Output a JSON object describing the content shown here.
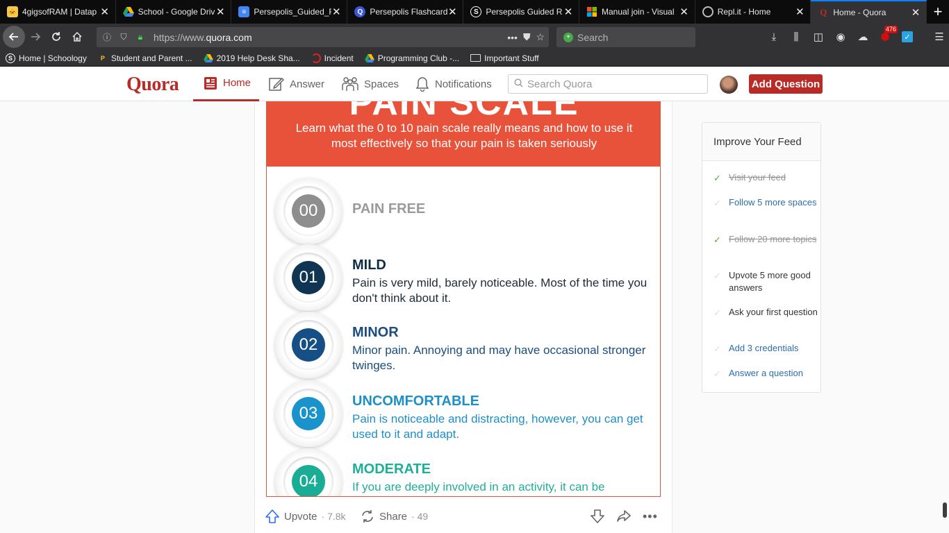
{
  "browser": {
    "tabs": [
      {
        "title": "4gigsofRAM | Datap",
        "icon": "cat-icon",
        "color": "#f2c94c"
      },
      {
        "title": "School - Google Driv",
        "icon": "google-drive-icon",
        "color": "#1fa463"
      },
      {
        "title": "Persepolis_Guided_F",
        "icon": "google-docs-icon",
        "color": "#4285f4"
      },
      {
        "title": "Persepolis Flashcard",
        "icon": "quizlet-icon",
        "color": "#3c56d6"
      },
      {
        "title": "Persepolis Guided R",
        "icon": "schoology-icon",
        "color": "#2b8bc9"
      },
      {
        "title": "Manual join - Visual",
        "icon": "microsoft-icon",
        "color": "#f25022"
      },
      {
        "title": "Repl.it - Home",
        "icon": "replit-icon",
        "color": "#888888"
      },
      {
        "title": "Home - Quora",
        "icon": "quora-icon",
        "color": "#b92b27",
        "active": true
      }
    ],
    "url_prefix": "https://www.",
    "url_domain": "quora.com",
    "search_placeholder": "Search",
    "badge_count": "476",
    "bookmarks": [
      {
        "label": "Home | Schoology",
        "icon": "schoology-icon"
      },
      {
        "label": "Student and Parent ...",
        "icon": "pearson-icon"
      },
      {
        "label": "2019 Help Desk Sha...",
        "icon": "google-drive-icon"
      },
      {
        "label": "Incident",
        "icon": "servicenow-icon"
      },
      {
        "label": "Programming Club -...",
        "icon": "google-drive-icon"
      },
      {
        "label": "Important Stuff",
        "icon": "folder-icon"
      }
    ]
  },
  "quora": {
    "logo": "Quora",
    "nav": {
      "home": "Home",
      "answer": "Answer",
      "spaces": "Spaces",
      "notifications": "Notifications"
    },
    "search_placeholder": "Search Quora",
    "add_question": "Add Question"
  },
  "infographic": {
    "big_title": "PAIN SCALE",
    "subtitle": "Learn what the 0 to 10 pain scale really means and how to use it most effectively so that your pain is taken seriously",
    "levels": [
      {
        "num": "00",
        "title": "PAIN FREE",
        "desc": "",
        "color": "#8e8e8e",
        "title_color": "#9a9a9a",
        "desc_color": "#333333"
      },
      {
        "num": "01",
        "title": "MILD",
        "desc": "Pain is very mild, barely noticeable. Most of the time you don't think about it.",
        "color": "#0f3552",
        "title_color": "#0f2c45",
        "desc_color": "#1d2b38"
      },
      {
        "num": "02",
        "title": "MINOR",
        "desc": "Minor pain. Annoying and may have occasional stronger twinges.",
        "color": "#154f86",
        "title_color": "#1b4d7e",
        "desc_color": "#1b4d7e"
      },
      {
        "num": "03",
        "title": "UNCOMFORTABLE",
        "desc": "Pain is noticeable and distracting, however, you can get used to it and adapt.",
        "color": "#1a93cc",
        "title_color": "#1e8fc6",
        "desc_color": "#1e8fc6"
      },
      {
        "num": "04",
        "title": "MODERATE",
        "desc": "If you are deeply involved in an activity, it can be",
        "color": "#1aad96",
        "title_color": "#1fae97",
        "desc_color": "#1fae97"
      }
    ]
  },
  "actions": {
    "upvote_label": "Upvote",
    "upvote_count": "7.8k",
    "share_label": "Share",
    "share_count": "49"
  },
  "sidebar": {
    "title": "Improve Your Feed",
    "items": [
      {
        "text": "Visit your feed",
        "state": "done"
      },
      {
        "text": "Follow 5 more spaces",
        "state": "link"
      },
      {
        "text": "Follow 20 more topics",
        "state": "done"
      },
      {
        "text": "Upvote 5 more good answers",
        "state": "plain"
      },
      {
        "text": "Ask your first question",
        "state": "plain"
      },
      {
        "text": "Add 3 credentials",
        "state": "link"
      },
      {
        "text": "Answer a question",
        "state": "link"
      }
    ]
  }
}
